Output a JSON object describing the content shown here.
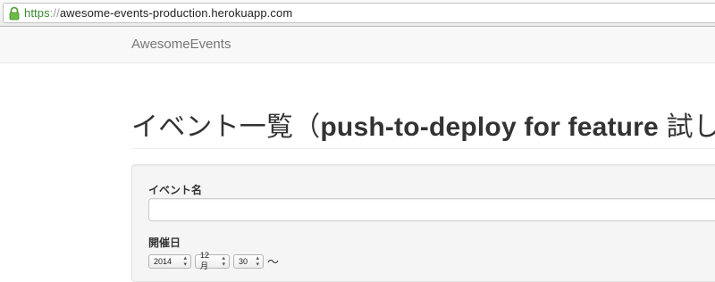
{
  "browser": {
    "url_scheme": "https",
    "url_separator": "://",
    "url_host": "awesome-events-production.herokuapp.com"
  },
  "navbar": {
    "brand": "AwesomeEvents"
  },
  "page": {
    "title_prefix": "イベント一覧（",
    "title_accent": "push-to-deploy for feature",
    "title_suffix": " 試し）"
  },
  "form": {
    "name_label": "イベント名",
    "name_value": "",
    "date_label": "開催日",
    "year": "2014",
    "month": "12月",
    "day": "30",
    "range_separator": "〜"
  },
  "colors": {
    "secure_scheme": "#3a8a2e",
    "navbar_bg": "#f8f8f8",
    "well_bg": "#f5f5f5"
  }
}
